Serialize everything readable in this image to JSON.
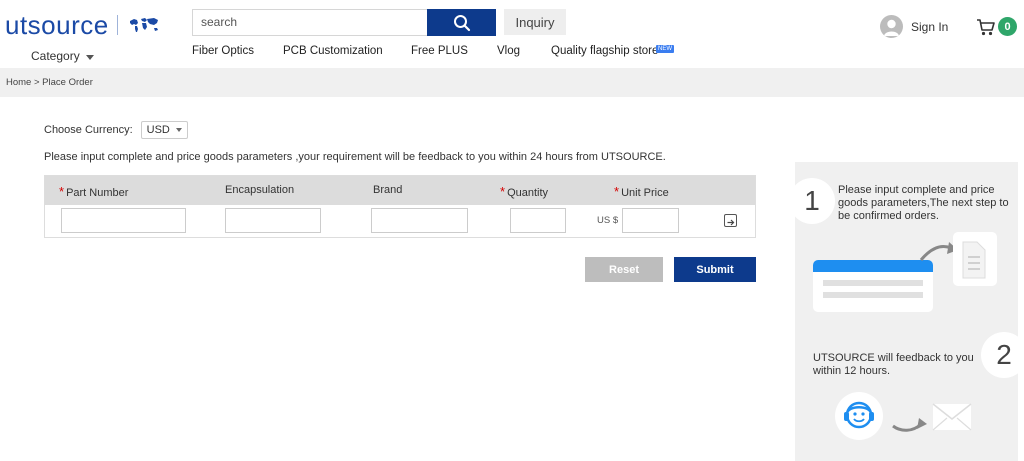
{
  "header": {
    "logo_text": "utsource",
    "category_label": "Category",
    "search_placeholder": "search",
    "inquiry_label": "Inquiry",
    "nav": [
      {
        "label": "Fiber Optics"
      },
      {
        "label": "PCB Customization"
      },
      {
        "label": "Free PLUS"
      },
      {
        "label": "Vlog"
      },
      {
        "label": "Quality flagship store"
      }
    ],
    "new_badge": "NEW",
    "signin_label": "Sign In",
    "cart_count": "0"
  },
  "breadcrumb": "Home > Place Order",
  "form": {
    "currency_label": "Choose Currency:",
    "currency_value": "USD",
    "instruction": "Please input complete and price goods parameters ,your requirement will be feedback to you within 24 hours from UTSOURCE.",
    "columns": {
      "part_number": "Part Number",
      "encapsulation": "Encapsulation",
      "brand": "Brand",
      "quantity": "Quantity",
      "unit_price": "Unit Price"
    },
    "required_mark": "*",
    "price_prefix": "US $",
    "reset_label": "Reset",
    "submit_label": "Submit"
  },
  "side": {
    "step1_num": "1",
    "step1_text": "Please input complete and price goods parameters,The next step to be confirmed orders.",
    "step2_num": "2",
    "step2_text": "UTSOURCE will feedback to you within 12 hours."
  },
  "colors": {
    "brand_blue": "#0d3a8c",
    "logo_blue": "#1b4aa6",
    "cart_green": "#2fa66a",
    "required_red": "#d40000"
  },
  "icons": [
    "world-map-icon",
    "search-icon",
    "user-icon",
    "cart-icon",
    "add-row-icon",
    "document-icon",
    "customer-service-icon",
    "envelope-icon"
  ]
}
